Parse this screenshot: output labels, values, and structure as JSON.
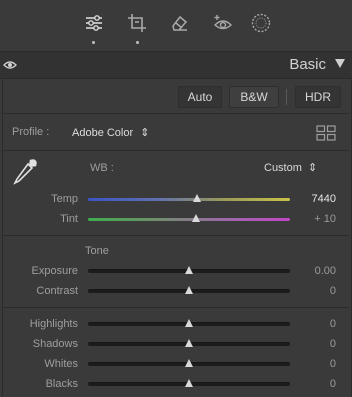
{
  "toolbar": {
    "tools": [
      {
        "icon": "edit-sliders-icon",
        "active": true
      },
      {
        "icon": "crop-icon",
        "active": false
      },
      {
        "icon": "healing-eraser-icon",
        "active": false
      },
      {
        "icon": "red-eye-icon",
        "active": false
      },
      {
        "icon": "masking-icon",
        "active": false
      }
    ]
  },
  "header": {
    "title": "Basic",
    "visibility_icon": "eye-icon",
    "collapse_icon": "triangle-down-icon"
  },
  "treatment": {
    "auto_label": "Auto",
    "bw_label": "B&W",
    "hdr_label": "HDR"
  },
  "profile": {
    "label": "Profile :",
    "value": "Adobe Color",
    "chevron": "⇕",
    "browser_icon": "grid-icon"
  },
  "wb": {
    "label": "WB :",
    "value": "Custom",
    "chevron": "⇕",
    "picker_icon": "eyedropper-icon"
  },
  "sliders_wb": [
    {
      "label": "Temp",
      "value": "7440",
      "position": 0.62,
      "track": "temp"
    },
    {
      "label": "Tint",
      "value": "+ 10",
      "position": 0.52,
      "track": "tint"
    }
  ],
  "tone": {
    "heading": "Tone",
    "sliders": [
      {
        "label": "Exposure",
        "value": "0.00",
        "position": 0.5
      },
      {
        "label": "Contrast",
        "value": "0",
        "position": 0.5
      }
    ]
  },
  "presence_sliders": [
    {
      "label": "Highlights",
      "value": "0",
      "position": 0.5
    },
    {
      "label": "Shadows",
      "value": "0",
      "position": 0.5
    },
    {
      "label": "Whites",
      "value": "0",
      "position": 0.5
    },
    {
      "label": "Blacks",
      "value": "0",
      "position": 0.5
    }
  ]
}
